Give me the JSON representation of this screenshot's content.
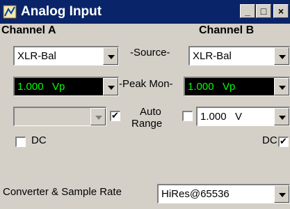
{
  "window": {
    "title": "Analog Input",
    "minimize": "_",
    "maximize": "□",
    "close": "×"
  },
  "channel_a": {
    "header": "Channel A",
    "source": "XLR-Bal",
    "peak_mon": "1.000   Vp",
    "range": "",
    "auto_range_checked": true,
    "dc_label": "DC",
    "dc_checked": false
  },
  "channel_b": {
    "header": "Channel B",
    "source": "XLR-Bal",
    "peak_mon": "1.000   Vp",
    "range": "1.000   V",
    "auto_range_checked": false,
    "dc_label": "DC",
    "dc_checked": true
  },
  "center": {
    "source_label": "-Source-",
    "peak_label": "-Peak Mon-",
    "auto_label": "Auto",
    "range_label": "Range"
  },
  "converter": {
    "label": "Converter & Sample Rate",
    "value": "HiRes@65536"
  },
  "colors": {
    "titlebar": "#0a246a",
    "meter_bg": "#000000",
    "meter_text": "#00ff00",
    "face": "#d4d0c8"
  }
}
